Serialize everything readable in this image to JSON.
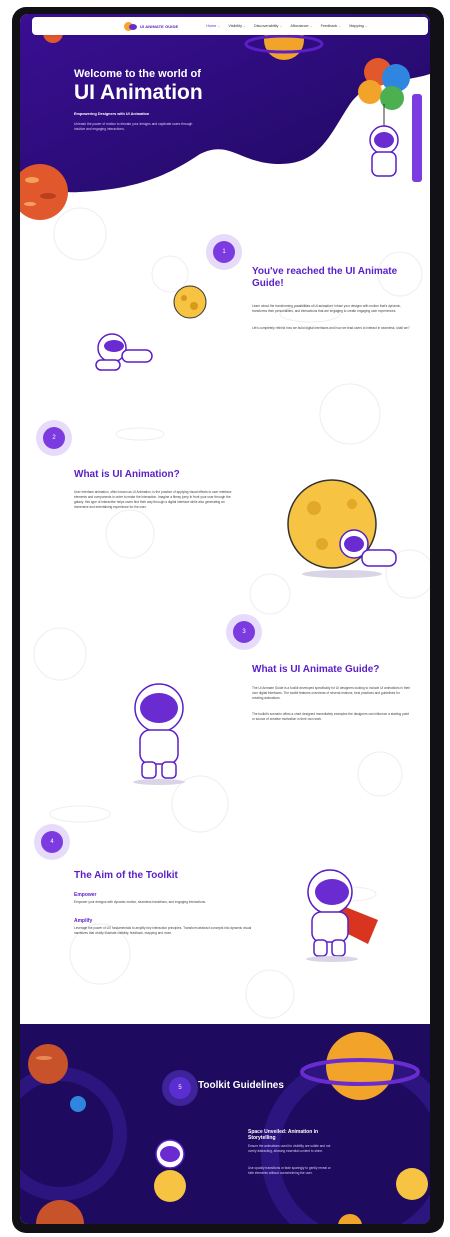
{
  "nav": {
    "logo_text": "UI ANIMATE GUIDE",
    "items": [
      {
        "label": "Home",
        "chevron": "⌄"
      },
      {
        "label": "Visibility",
        "chevron": "⌄"
      },
      {
        "label": "Discoverability",
        "chevron": "⌄"
      },
      {
        "label": "Affordance",
        "chevron": "⌄"
      },
      {
        "label": "Feedback",
        "chevron": "⌄"
      },
      {
        "label": "Mapping",
        "chevron": "⌄"
      }
    ]
  },
  "hero": {
    "title_small": "Welcome to the world of",
    "title_large": "UI Animation",
    "subtitle": "Empowering Designers with UI Animation",
    "description": "Unleash the power of motion to elevate your designs and captivate users through intuitive and engaging interactions."
  },
  "sections": [
    {
      "number": "1",
      "title": "You've reached the UI Animate Guide!",
      "paragraphs": [
        "Learn about the transforming possibilities of UI animation! Infuse your designs with motion that's dynamic, transforms their personalities, and interactions that are engaging to create engaging user experiences.",
        "Let's completely rethink how we build digital interfaces and how we lead users to interact in seamless, shall we?"
      ]
    },
    {
      "number": "2",
      "title": "What is UI Animation?",
      "paragraphs": [
        "User interface animation, often known as UI Animation, is the practice of applying visual effects to user interface elements and components in order to make the interaction. Imagine a flimsy jump in front your user through the galaxy: this type of interactive helps users find their way through a digital interface while also generating an immersive and entertaining experience for the user."
      ]
    },
    {
      "number": "3",
      "title": "What is UI Animate Guide?",
      "paragraphs": [
        "The UI Animate Guide is a toolkit developed specifically for UI designers looking to include UI animations in their own digital interfaces. The toolkit features overviews of several motions, best practices and guidelines for creating animations.",
        "The toolkit's scenario offers a chart designed immediately examples the designers can influence a starting point or source of creative motivation in their own work."
      ]
    },
    {
      "number": "4",
      "title": "The Aim of the Toolkit",
      "items": [
        {
          "heading": "Empower",
          "text": "Empower your designs with dynamic motion, seamless transitions, and engaging interactions."
        },
        {
          "heading": "Amplify",
          "text": "Leverage the power of UX fundamentals to amplify key interaction principles. Transform abstract concepts into dynamic visual narratives that vividly illustrate visibility, feedback, mapping and more."
        }
      ]
    }
  ],
  "footer": {
    "number": "5",
    "title": "Toolkit Guidelines",
    "card_heading": "Space Unveiled: Animation in Storytelling",
    "card_paragraphs": [
      "Ensure the animations used for visibility are subtle and not overly distracting, allowing essential content to shine.",
      "Use opacity transitions or fade sparingly to gently reveal or hide elements without overwhelming the user."
    ]
  },
  "colors": {
    "primary": "#5a1fc6",
    "hero_bg": "#2a0c7a",
    "badge_bg": "#e7dbfb",
    "footer_bg": "#1e0a5e"
  }
}
